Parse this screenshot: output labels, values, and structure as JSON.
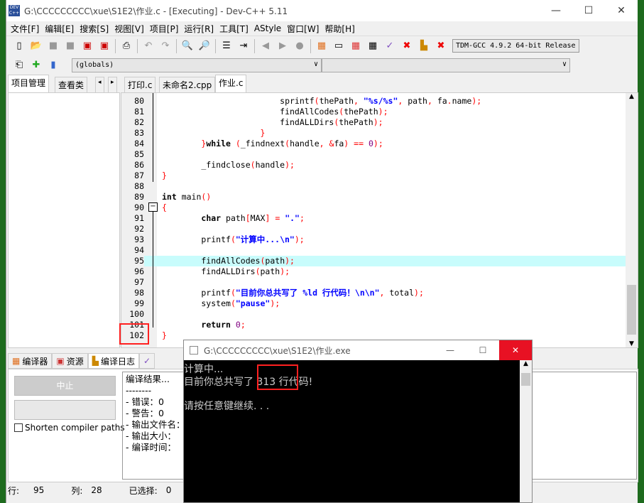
{
  "window": {
    "title": "G:\\CCCCCCCCC\\xue\\S1E2\\作业.c - [Executing] - Dev-C++ 5.11",
    "minimize": "—",
    "maximize": "☐",
    "close": "✕"
  },
  "menu": [
    "文件[F]",
    "编辑[E]",
    "搜索[S]",
    "视图[V]",
    "项目[P]",
    "运行[R]",
    "工具[T]",
    "AStyle",
    "窗口[W]",
    "帮助[H]"
  ],
  "toolbar": {
    "compiler": "TDM-GCC 4.9.2 64-bit Release",
    "scope": "(globals)",
    "symbol": ""
  },
  "side_tabs": [
    "项目管理",
    "查看类"
  ],
  "file_tabs": [
    "打印.c",
    "未命名2.cpp",
    "作业.c"
  ],
  "code": [
    {
      "n": "80",
      "t": [
        [
          "                        sprintf",
          ""
        ],
        [
          "(",
          "p"
        ],
        [
          "thePath",
          ""
        ],
        [
          ",",
          "p"
        ],
        [
          " ",
          ""
        ],
        [
          "\"%s/%s\"",
          "s"
        ],
        [
          ",",
          "p"
        ],
        [
          " path",
          ""
        ],
        [
          ",",
          "p"
        ],
        [
          " fa",
          ""
        ],
        [
          ".",
          "p"
        ],
        [
          "name",
          ""
        ],
        [
          ");",
          "p"
        ]
      ]
    },
    {
      "n": "81",
      "t": [
        [
          "                        findAllCodes",
          ""
        ],
        [
          "(",
          "p"
        ],
        [
          "thePath",
          ""
        ],
        [
          ");",
          "p"
        ]
      ]
    },
    {
      "n": "82",
      "t": [
        [
          "                        findALLDirs",
          ""
        ],
        [
          "(",
          "p"
        ],
        [
          "thePath",
          ""
        ],
        [
          ");",
          "p"
        ]
      ]
    },
    {
      "n": "83",
      "t": [
        [
          "                    ",
          ""
        ],
        [
          "}",
          "p"
        ]
      ]
    },
    {
      "n": "84",
      "t": [
        [
          "        ",
          ""
        ],
        [
          "}",
          "p"
        ],
        [
          "while",
          "k"
        ],
        [
          " ",
          ""
        ],
        [
          "(",
          "p"
        ],
        [
          "_findnext",
          ""
        ],
        [
          "(",
          "p"
        ],
        [
          "handle",
          ""
        ],
        [
          ",",
          "p"
        ],
        [
          " ",
          ""
        ],
        [
          "&",
          "p"
        ],
        [
          "fa",
          ""
        ],
        [
          ")",
          "p"
        ],
        [
          " ",
          ""
        ],
        [
          "==",
          "p"
        ],
        [
          " ",
          ""
        ],
        [
          "0",
          "n"
        ],
        [
          ");",
          "p"
        ]
      ]
    },
    {
      "n": "85",
      "t": []
    },
    {
      "n": "86",
      "t": [
        [
          "        _findclose",
          ""
        ],
        [
          "(",
          "p"
        ],
        [
          "handle",
          ""
        ],
        [
          ");",
          "p"
        ]
      ]
    },
    {
      "n": "87",
      "t": [
        [
          "}",
          "p"
        ]
      ]
    },
    {
      "n": "88",
      "t": []
    },
    {
      "n": "89",
      "t": [
        [
          "int",
          "k"
        ],
        [
          " main",
          ""
        ],
        [
          "()",
          "p"
        ]
      ]
    },
    {
      "n": "90",
      "t": [
        [
          "{",
          "p"
        ]
      ]
    },
    {
      "n": "91",
      "t": [
        [
          "        ",
          ""
        ],
        [
          "char",
          "k"
        ],
        [
          " path",
          ""
        ],
        [
          "[",
          "p"
        ],
        [
          "MAX",
          ""
        ],
        [
          "]",
          "p"
        ],
        [
          " ",
          ""
        ],
        [
          "=",
          "p"
        ],
        [
          " ",
          ""
        ],
        [
          "\".\"",
          "s"
        ],
        [
          ";",
          "p"
        ]
      ]
    },
    {
      "n": "92",
      "t": []
    },
    {
      "n": "93",
      "t": [
        [
          "        printf",
          ""
        ],
        [
          "(",
          "p"
        ],
        [
          "\"计算中...\\n\"",
          "s"
        ],
        [
          ");",
          "p"
        ]
      ]
    },
    {
      "n": "94",
      "t": []
    },
    {
      "n": "95",
      "t": [
        [
          "        findAllCodes",
          ""
        ],
        [
          "(",
          "p"
        ],
        [
          "path",
          ""
        ],
        [
          ");",
          "p"
        ]
      ]
    },
    {
      "n": "96",
      "t": [
        [
          "        findALLDirs",
          ""
        ],
        [
          "(",
          "p"
        ],
        [
          "path",
          ""
        ],
        [
          ");",
          "p"
        ]
      ]
    },
    {
      "n": "97",
      "t": []
    },
    {
      "n": "98",
      "t": [
        [
          "        printf",
          ""
        ],
        [
          "(",
          "p"
        ],
        [
          "\"目前你总共写了 %ld 行代码！\\n\\n\"",
          "s"
        ],
        [
          ",",
          "p"
        ],
        [
          " total",
          ""
        ],
        [
          ");",
          "p"
        ]
      ]
    },
    {
      "n": "99",
      "t": [
        [
          "        system",
          ""
        ],
        [
          "(",
          "p"
        ],
        [
          "\"pause\"",
          "s"
        ],
        [
          ");",
          "p"
        ]
      ]
    },
    {
      "n": "100",
      "t": []
    },
    {
      "n": "101",
      "t": [
        [
          "        ",
          ""
        ],
        [
          "return",
          "k"
        ],
        [
          " ",
          ""
        ],
        [
          "0",
          "n"
        ],
        [
          ";",
          "p"
        ]
      ]
    },
    {
      "n": "102",
      "t": [
        [
          "}",
          "p"
        ]
      ]
    }
  ],
  "bottom_tabs": [
    "编译器",
    "资源",
    "编译日志"
  ],
  "bottom": {
    "abort": "中止",
    "shorten": "Shorten compiler paths",
    "log": [
      "编译结果...",
      "--------",
      "- 错误：0",
      "- 警告：0",
      "- 输出文件名：",
      "- 输出大小：",
      "- 编译时间："
    ]
  },
  "status": {
    "row_label": "行:",
    "row": "95",
    "col_label": "列:",
    "col": "28",
    "sel_label": "已选择:",
    "sel": "0"
  },
  "console": {
    "title": "G:\\CCCCCCCCC\\xue\\S1E2\\作业.exe",
    "lines": [
      "计算中...",
      "目前你总共写了 313 行代码!",
      "",
      "请按任意键继续. . ."
    ]
  },
  "colors": {
    "keyword": "#000000",
    "string": "#0000ff",
    "symbol": "#ff0000",
    "number": "#800080",
    "current_line": "#c8fcfc",
    "highlight_box": "#ff2020"
  }
}
